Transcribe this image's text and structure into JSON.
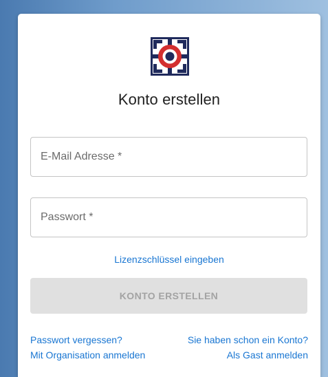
{
  "title": "Konto erstellen",
  "email": {
    "placeholder": "E-Mail Adresse *",
    "value": ""
  },
  "password": {
    "placeholder": "Passwort *",
    "value": ""
  },
  "license_link": "Lizenzschlüssel eingeben",
  "submit_label": "KONTO ERSTELLEN",
  "links": {
    "forgot": "Passwort vergessen?",
    "org_login": "Mit Organisation anmelden",
    "have_account": "Sie haben schon ein Konto?",
    "guest_login": "Als Gast anmelden"
  },
  "icons": {
    "logo": "target-logo-icon"
  },
  "colors": {
    "link": "#1976d2",
    "logo_navy": "#1f2a5c",
    "logo_red": "#d32f2f",
    "button_disabled_bg": "#e0e0e0",
    "button_disabled_text": "#a3a3a3"
  }
}
